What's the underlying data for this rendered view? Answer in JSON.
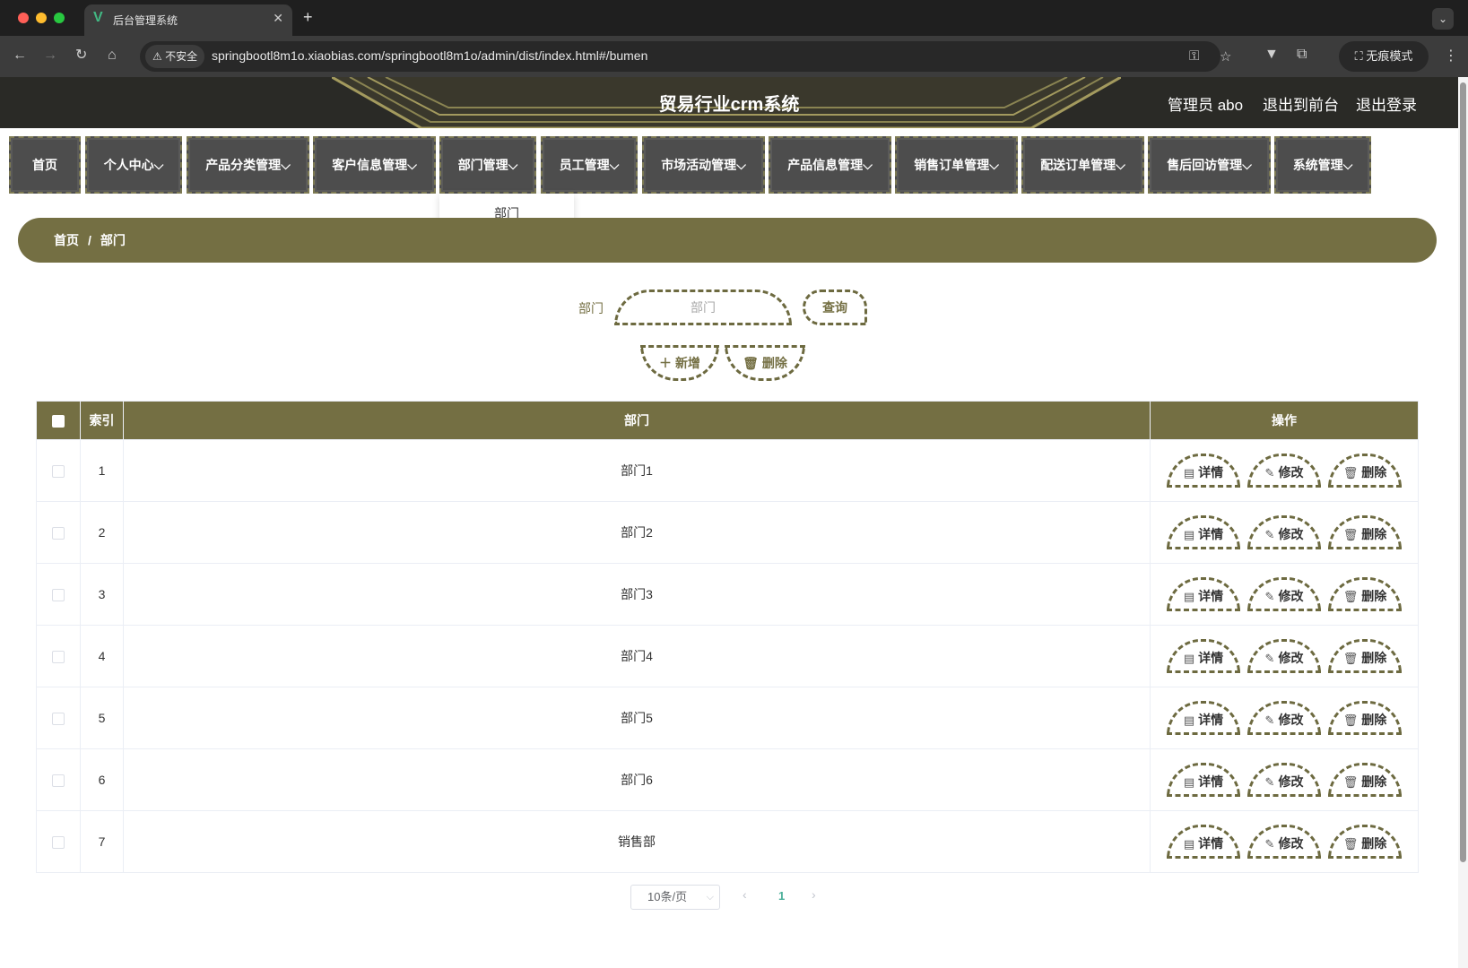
{
  "browser": {
    "tab_title": "后台管理系统",
    "favicon": "V",
    "security_label": "不安全",
    "url": "springbootl8m1o.xiaobias.com/springbootl8m1o/admin/dist/index.html#/bumen",
    "incognito_label": "无痕模式"
  },
  "header": {
    "title": "贸易行业crm系统",
    "user_label": "管理员 abo",
    "front_link": "退出到前台",
    "logout_link": "退出登录"
  },
  "menu": {
    "items": [
      {
        "label": "首页"
      },
      {
        "label": "个人中心"
      },
      {
        "label": "产品分类管理"
      },
      {
        "label": "客户信息管理"
      },
      {
        "label": "部门管理"
      },
      {
        "label": "员工管理"
      },
      {
        "label": "市场活动管理"
      },
      {
        "label": "产品信息管理"
      },
      {
        "label": "销售订单管理"
      },
      {
        "label": "配送订单管理"
      },
      {
        "label": "售后回访管理"
      },
      {
        "label": "系统管理"
      }
    ],
    "dropdown_item": "部门"
  },
  "breadcrumb": {
    "home": "首页",
    "separator": "/",
    "current": "部门"
  },
  "search": {
    "label": "部门",
    "placeholder": "部门",
    "query_button": "查询",
    "add_button": "新增",
    "delete_button": "删除"
  },
  "table": {
    "headers": {
      "index": "索引",
      "department": "部门",
      "actions": "操作"
    },
    "rows": [
      {
        "index": "1",
        "name": "部门1"
      },
      {
        "index": "2",
        "name": "部门2"
      },
      {
        "index": "3",
        "name": "部门3"
      },
      {
        "index": "4",
        "name": "部门4"
      },
      {
        "index": "5",
        "name": "部门5"
      },
      {
        "index": "6",
        "name": "部门6"
      },
      {
        "index": "7",
        "name": "销售部"
      }
    ],
    "row_actions": {
      "detail": "详情",
      "edit": "修改",
      "delete": "删除"
    }
  },
  "pagination": {
    "page_size": "10条/页",
    "current_page": "1"
  },
  "colors": {
    "accent": "#746f43",
    "menu_bg": "#4d4d4d",
    "header_bg": "#2a2a26"
  }
}
